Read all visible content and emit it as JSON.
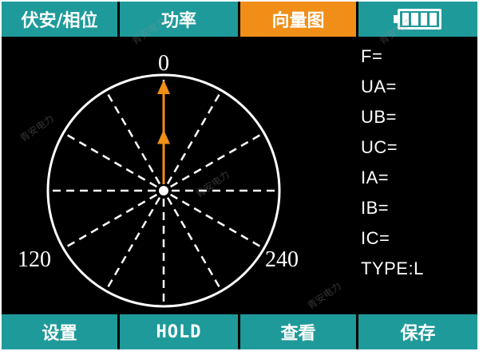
{
  "tabs": [
    {
      "label": "伏安/相位"
    },
    {
      "label": "功率"
    },
    {
      "label": "向量图",
      "active": true
    }
  ],
  "battery": {
    "icon": "battery-icon",
    "level": 1.0
  },
  "vector_plot": {
    "angle_labels": {
      "top": "0",
      "left": "120",
      "right": "240"
    },
    "vector_color": "#f08e18",
    "vectors": [
      {
        "angle_deg": 0,
        "magnitude": 1.0
      },
      {
        "angle_deg": 0,
        "magnitude": 0.55
      }
    ]
  },
  "readout": [
    "F=",
    "UA=",
    "UB=",
    "UC=",
    "IA=",
    "IB=",
    "IC=",
    "TYPE:L"
  ],
  "bottom_buttons": [
    {
      "label": "设置"
    },
    {
      "label": "HOLD"
    },
    {
      "label": "查看"
    },
    {
      "label": "保存"
    }
  ],
  "watermark": "青安电力",
  "colors": {
    "bar": "#1f9a9a",
    "active_tab": "#f08e18",
    "background": "#000000"
  }
}
